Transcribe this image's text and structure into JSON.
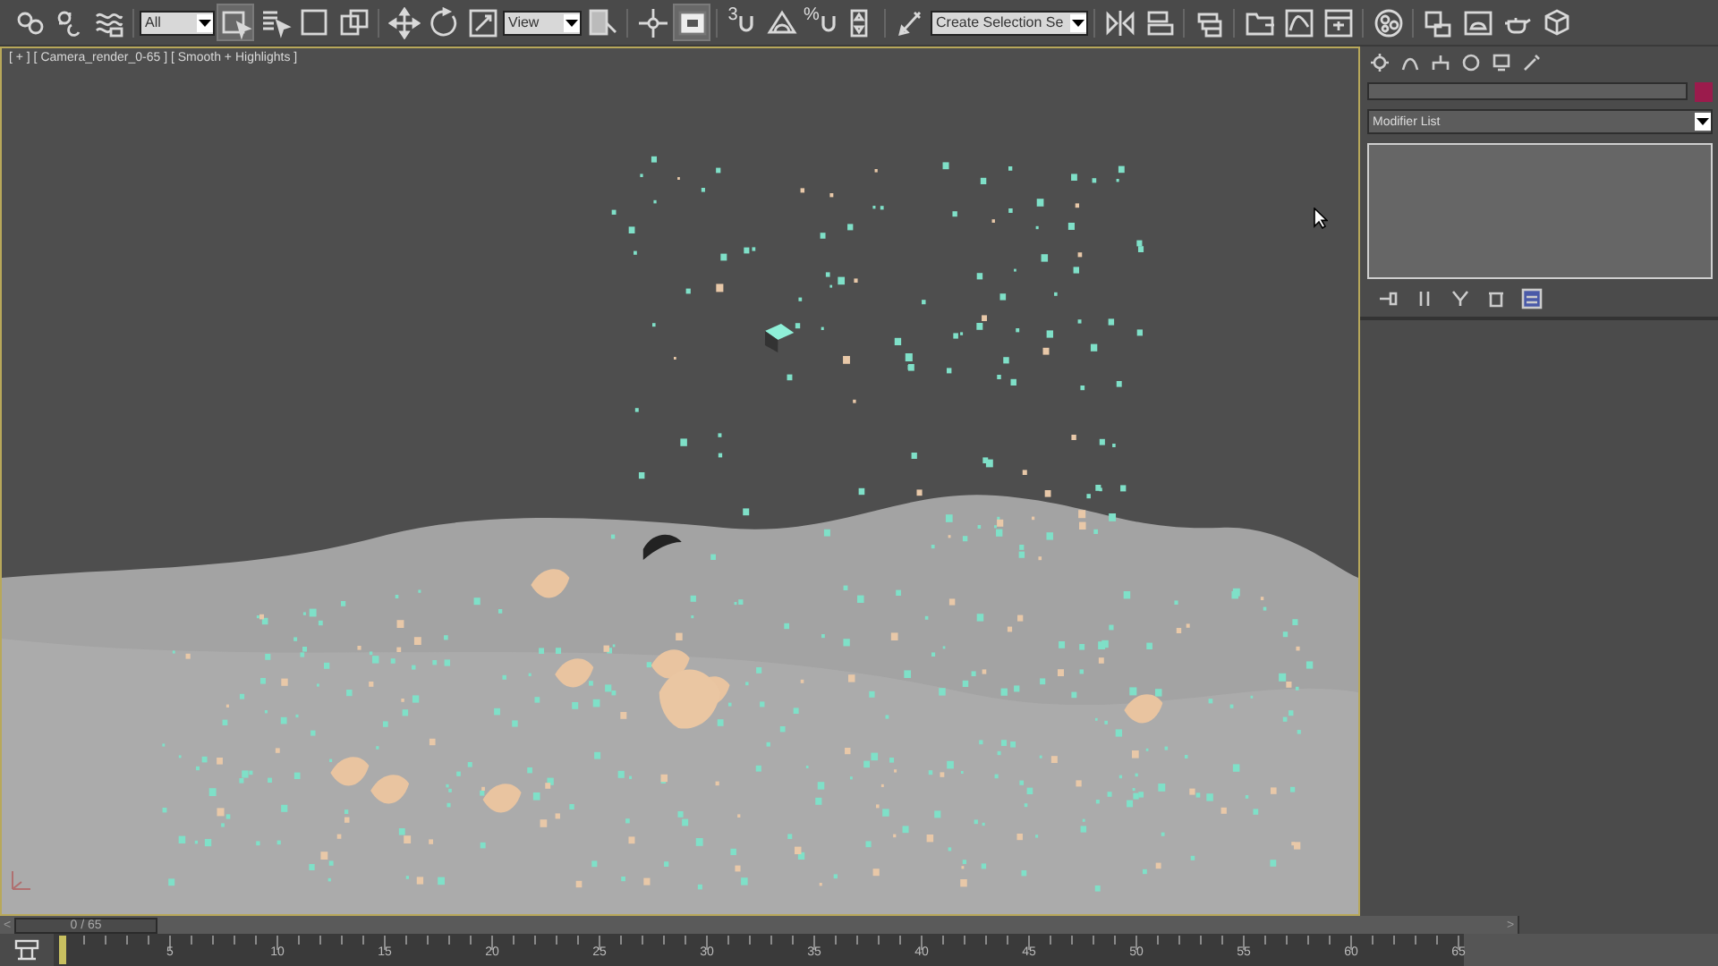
{
  "toolbar": {
    "filter_dropdown": "All",
    "coordinate_dropdown": "View",
    "snaps": [
      {
        "label": "3"
      },
      {
        "label": "%"
      }
    ],
    "selection_set_dropdown": "Create Selection Se"
  },
  "viewport": {
    "label": "[ + ] [ Camera_render_0-65 ] [ Smooth + Highlights ]",
    "active": true
  },
  "command_panel": {
    "modifier_list": "Modifier List"
  },
  "timeline": {
    "previous": "<",
    "frame": "0 / 65",
    "next": ">",
    "level": 0,
    "ruler_labels": [
      "5",
      "10",
      "15",
      "20",
      "25",
      "30",
      "35",
      "40",
      "45",
      "50",
      "55",
      "60",
      "65"
    ]
  }
}
